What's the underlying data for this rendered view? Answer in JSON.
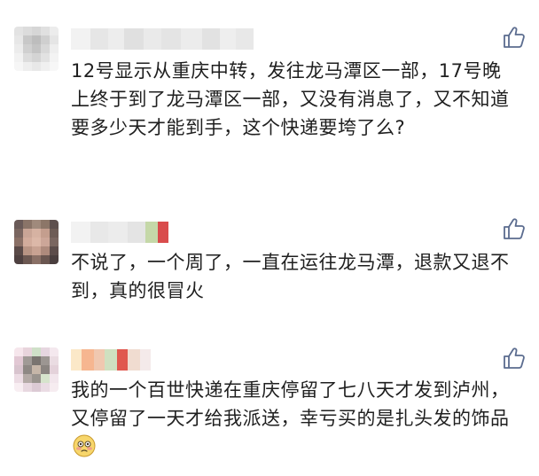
{
  "comments": [
    {
      "text": "12号显示从重庆中转，发往龙马潭区一部，17号晚上终于到了龙马潭区一部，又没有消息了，又不知道要多少天才能到手，这个快递要垮了么?",
      "avatar_icon": "blurred-avatar-icon",
      "like_icon": "thumbs-up-icon"
    },
    {
      "text": "不说了，一个周了，一直在运往龙马潭，退款又退不到，真的很冒火",
      "avatar_icon": "blurred-avatar-icon",
      "like_icon": "thumbs-up-icon"
    },
    {
      "text": "我的一个百世快递在重庆停留了七八天才发到泸州，又停留了一天才给我派送，幸亏买的是扎头发的饰品",
      "avatar_icon": "blurred-avatar-icon",
      "like_icon": "thumbs-up-icon",
      "emoji_icon": "flushed-face-emoji-icon"
    }
  ],
  "colors": {
    "text": "#1f1f1f",
    "like_icon": "#5b6c8f",
    "background": "#ffffff"
  }
}
